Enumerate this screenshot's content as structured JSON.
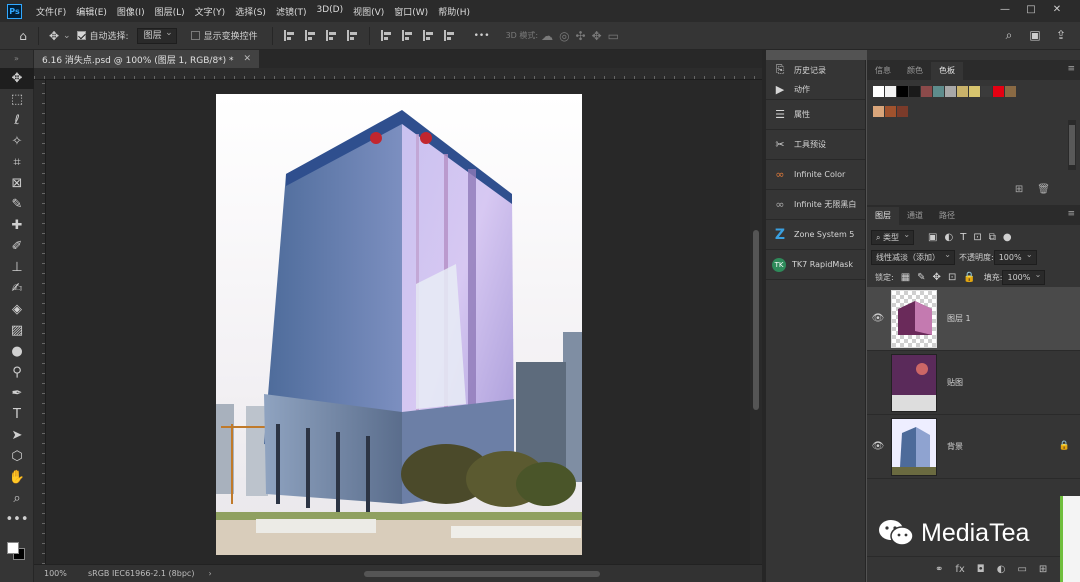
{
  "app": {
    "logo": "Ps",
    "menu": [
      "文件(F)",
      "编辑(E)",
      "图像(I)",
      "图层(L)",
      "文字(Y)",
      "选择(S)",
      "滤镜(T)",
      "3D(D)",
      "视图(V)",
      "窗口(W)",
      "帮助(H)"
    ],
    "window_controls": [
      "—",
      "□",
      "✕"
    ]
  },
  "options": {
    "auto_select_label": "自动选择:",
    "auto_select_value": "图层",
    "show_transform_label": "显示变换控件",
    "more_label": "•••",
    "mode_3d_label": "3D 模式:"
  },
  "document": {
    "tab_title": "6.16 消失点.psd @ 100% (图层 1, RGB/8*) *",
    "zoom": "100%",
    "color_profile": "sRGB IEC61966-2.1 (8bpc)"
  },
  "dock": {
    "items": [
      {
        "label": "历史记录",
        "icon": "history-icon"
      },
      {
        "label": "动作",
        "icon": "play-icon"
      },
      {
        "label": "属性",
        "icon": "properties-icon"
      },
      {
        "label": "工具预设",
        "icon": "tool-presets-icon"
      },
      {
        "label": "Infinite Color",
        "icon": "infinite-color-icon"
      },
      {
        "label": "Infinite 无限黑白",
        "icon": "infinite-bw-icon"
      },
      {
        "label": "Zone System 5",
        "icon": "zone-system-icon"
      },
      {
        "label": "TK7 RapidMask",
        "icon": "tk7-icon"
      }
    ]
  },
  "swatches_panel": {
    "tabs": [
      "信息",
      "颜色",
      "色板"
    ],
    "active_tab": "色板",
    "row1": [
      "#ffffff",
      "#f2f2f2",
      "#000000",
      "#1a1a1a",
      "#8b4a4a",
      "#5e8c8c",
      "#a8a8a8",
      "#c9b26a",
      "#d7c46e",
      "#3b3b3b",
      "#e60012",
      "#8a6a44"
    ],
    "row2": [
      "#d9a57a",
      "#a0522d",
      "#7b3b2a"
    ]
  },
  "layers_panel": {
    "tabs": [
      "图层",
      "通道",
      "路径"
    ],
    "active_tab": "图层",
    "filter_label": "类型",
    "blend_mode": "线性减淡（添加）",
    "opacity_label": "不透明度:",
    "opacity_value": "100%",
    "lock_label": "锁定:",
    "fill_label": "填充:",
    "fill_value": "100%",
    "layers": [
      {
        "name": "图层 1",
        "visible": true,
        "selected": true
      },
      {
        "name": "贴图",
        "visible": false,
        "selected": false
      },
      {
        "name": "背景",
        "visible": true,
        "selected": false,
        "locked": true
      }
    ]
  },
  "watermark": {
    "text": "MediaTea"
  }
}
